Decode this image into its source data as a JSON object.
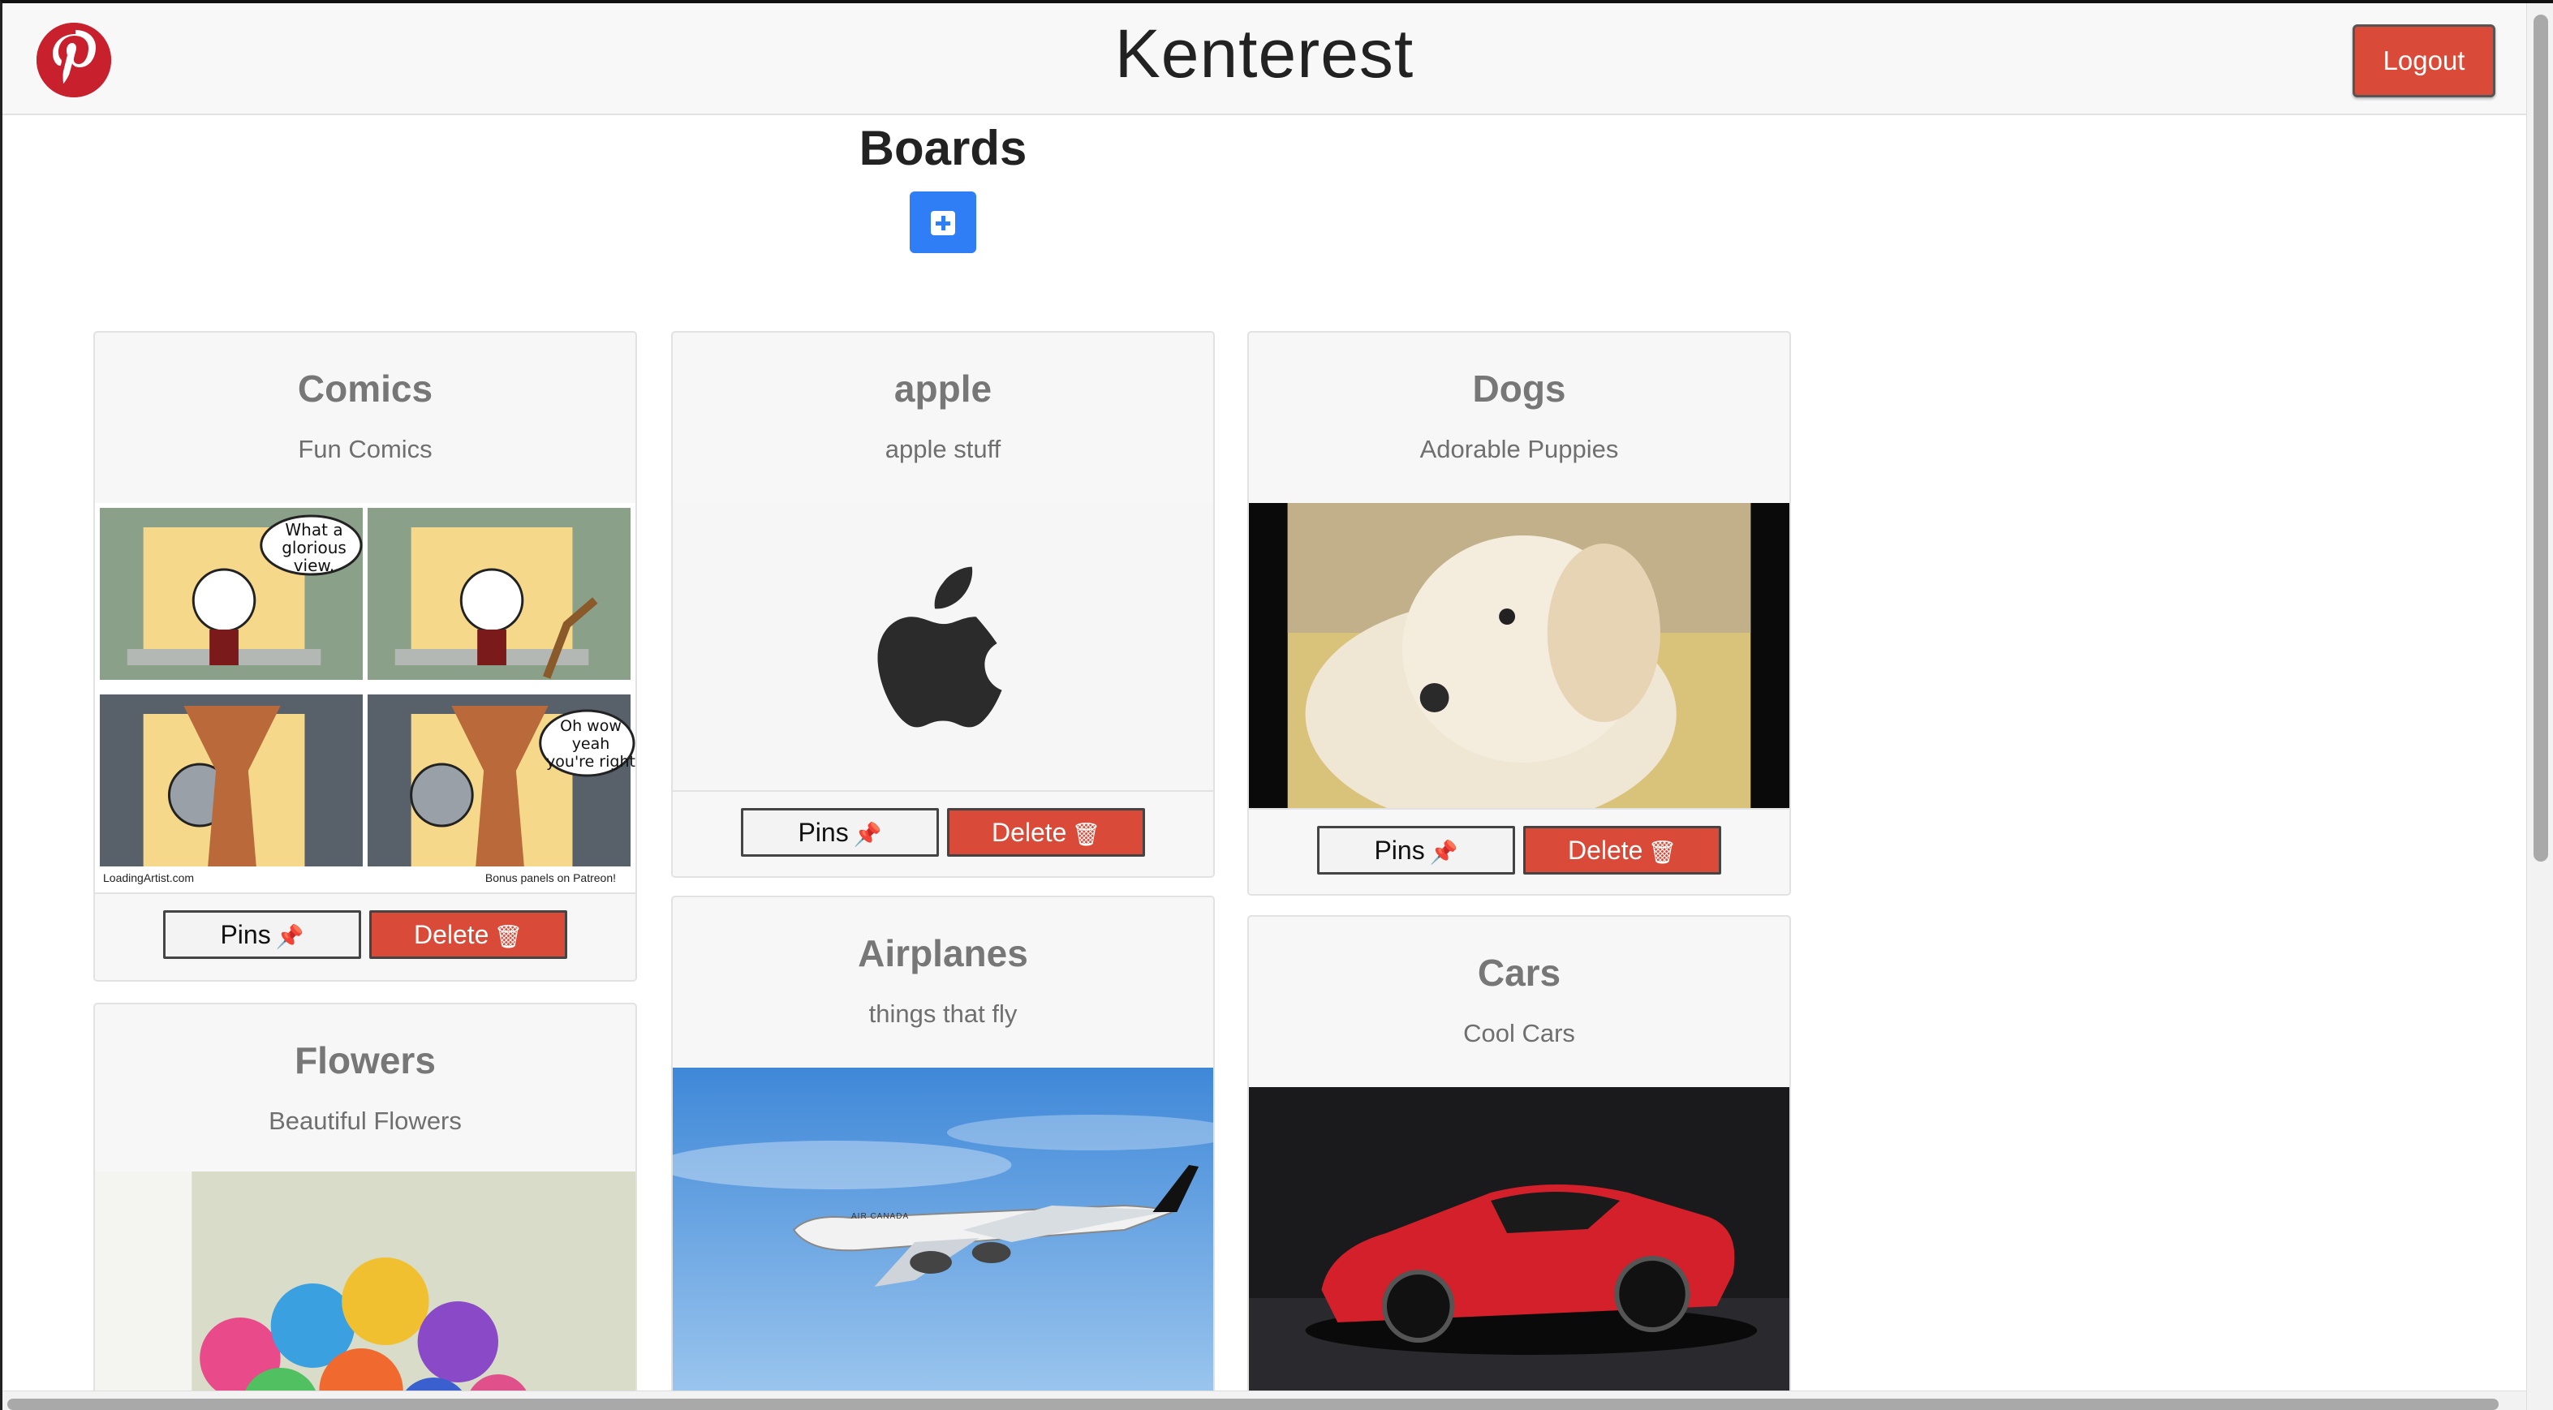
{
  "header": {
    "brand": "Kenterest",
    "logout_label": "Logout",
    "brand_color": "#c8202c",
    "logout_color": "#d94b38"
  },
  "main": {
    "title": "Boards",
    "add_icon": "plus-square-icon",
    "add_color": "#2f7ef6"
  },
  "boards": [
    {
      "title": "Comics",
      "description": "Fun Comics",
      "pins_label": "Pins",
      "delete_label": "Delete",
      "comic_text_1": "What a glorious view.",
      "comic_text_2": "Oh wow yeah you're right",
      "comic_footer_left": "LoadingArtist.com",
      "comic_footer_right": "Bonus panels on Patreon!"
    },
    {
      "title": "apple",
      "description": "apple stuff",
      "pins_label": "Pins",
      "delete_label": "Delete"
    },
    {
      "title": "Dogs",
      "description": "Adorable Puppies",
      "pins_label": "Pins",
      "delete_label": "Delete"
    },
    {
      "title": "Flowers",
      "description": "Beautiful Flowers"
    },
    {
      "title": "Airplanes",
      "description": "things that fly",
      "plane_text": "AIR CANADA"
    },
    {
      "title": "Cars",
      "description": "Cool Cars"
    }
  ],
  "icons": {
    "pin": "pin-icon",
    "trash": "trash-icon"
  }
}
